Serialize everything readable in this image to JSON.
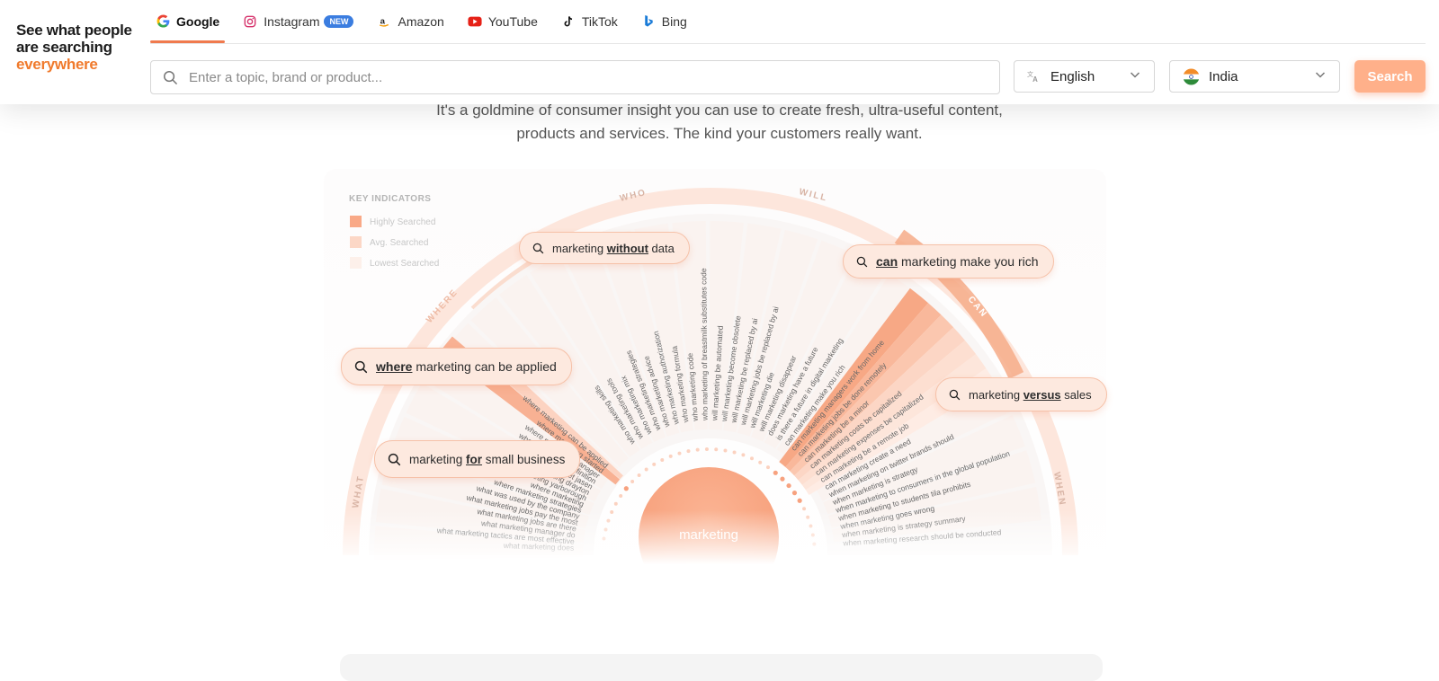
{
  "logo": {
    "line1": "See what people",
    "line2": "are searching",
    "line3": "everywhere"
  },
  "tabs": [
    {
      "label": "Google",
      "icon": "google-icon",
      "active": true
    },
    {
      "label": "Instagram",
      "icon": "instagram-icon",
      "badge": "NEW"
    },
    {
      "label": "Amazon",
      "icon": "amazon-icon"
    },
    {
      "label": "YouTube",
      "icon": "youtube-icon"
    },
    {
      "label": "TikTok",
      "icon": "tiktok-icon"
    },
    {
      "label": "Bing",
      "icon": "bing-icon"
    }
  ],
  "search": {
    "placeholder": "Enter a topic, brand or product...",
    "value": "",
    "language": "English",
    "country": "India",
    "button_label": "Search"
  },
  "intro": {
    "line1": "It's a goldmine of consumer insight you can use to create fresh, ultra-useful content,",
    "line2": "products and services. The kind your customers really want."
  },
  "colors": {
    "accent": "#f07a4e",
    "pill_bg": "#fde9df",
    "search_button": "#ffb08a",
    "core": "#f9a985"
  },
  "viz": {
    "legend": {
      "title": "KEY INDICATORS",
      "items": [
        "Highly Searched",
        "Avg. Searched",
        "Lowest Searched"
      ]
    },
    "categories": [
      "WHO",
      "WILL",
      "WHERE",
      "CAN",
      "WHAT",
      "WHEN"
    ],
    "core": "marketing",
    "pills": [
      {
        "pre": "marketing ",
        "kw": "without",
        "post": " data"
      },
      {
        "pre": "",
        "kw": "can",
        "post": " marketing make you rich"
      },
      {
        "pre": "",
        "kw": "where",
        "post": " marketing can be applied"
      },
      {
        "pre": "marketing ",
        "kw": "versus",
        "post": " sales"
      },
      {
        "pre": "marketing ",
        "kw": "for",
        "post": " small business"
      }
    ],
    "left_phrases": [
      "what marketing does",
      "what marketing tactics are most effective",
      "what marketing manager do",
      "what marketing jobs are there",
      "what marketing jobs pay the most",
      "what was used by the company",
      "where marketing strategies",
      "where marketing",
      "where's marketing yarborough",
      "where's marketing drayton",
      "where's market jasen",
      "where marketing definition",
      "where marketing manager",
      "where marketing started",
      "where marketing can be applied"
    ],
    "top_phrases": [
      "who marketing skills",
      "who marketing tools",
      "who marketing mix",
      "who marketing strategies",
      "who marketing advice",
      "who marketing authorization",
      "who marketing formula",
      "who marketing code",
      "who marketing of breastmilk substitutes code",
      "will marketing be automated",
      "will marketing become obsolete",
      "will marketing be replaced by ai",
      "will marketing jobs be replaced by ai",
      "will marketing die",
      "will marketing disappear",
      "does marketing have a future",
      "is there a future in digital marketing"
    ],
    "right_phrases": [
      "can marketing make you rich",
      "can marketing managers work from home",
      "can marketing jobs be done remotely",
      "can marketing be a minor",
      "can marketing costs be capitalized",
      "can marketing expenses be capitalized",
      "can marketing be a remote job",
      "can marketing create a need",
      "when marketing on twitter brands should",
      "when marketing is strategy",
      "when marketing to consumers in the global population",
      "when marketing to students tila prohibits",
      "when marketing goes wrong",
      "when marketing is strategy summary",
      "when marketing research should be conducted"
    ]
  }
}
